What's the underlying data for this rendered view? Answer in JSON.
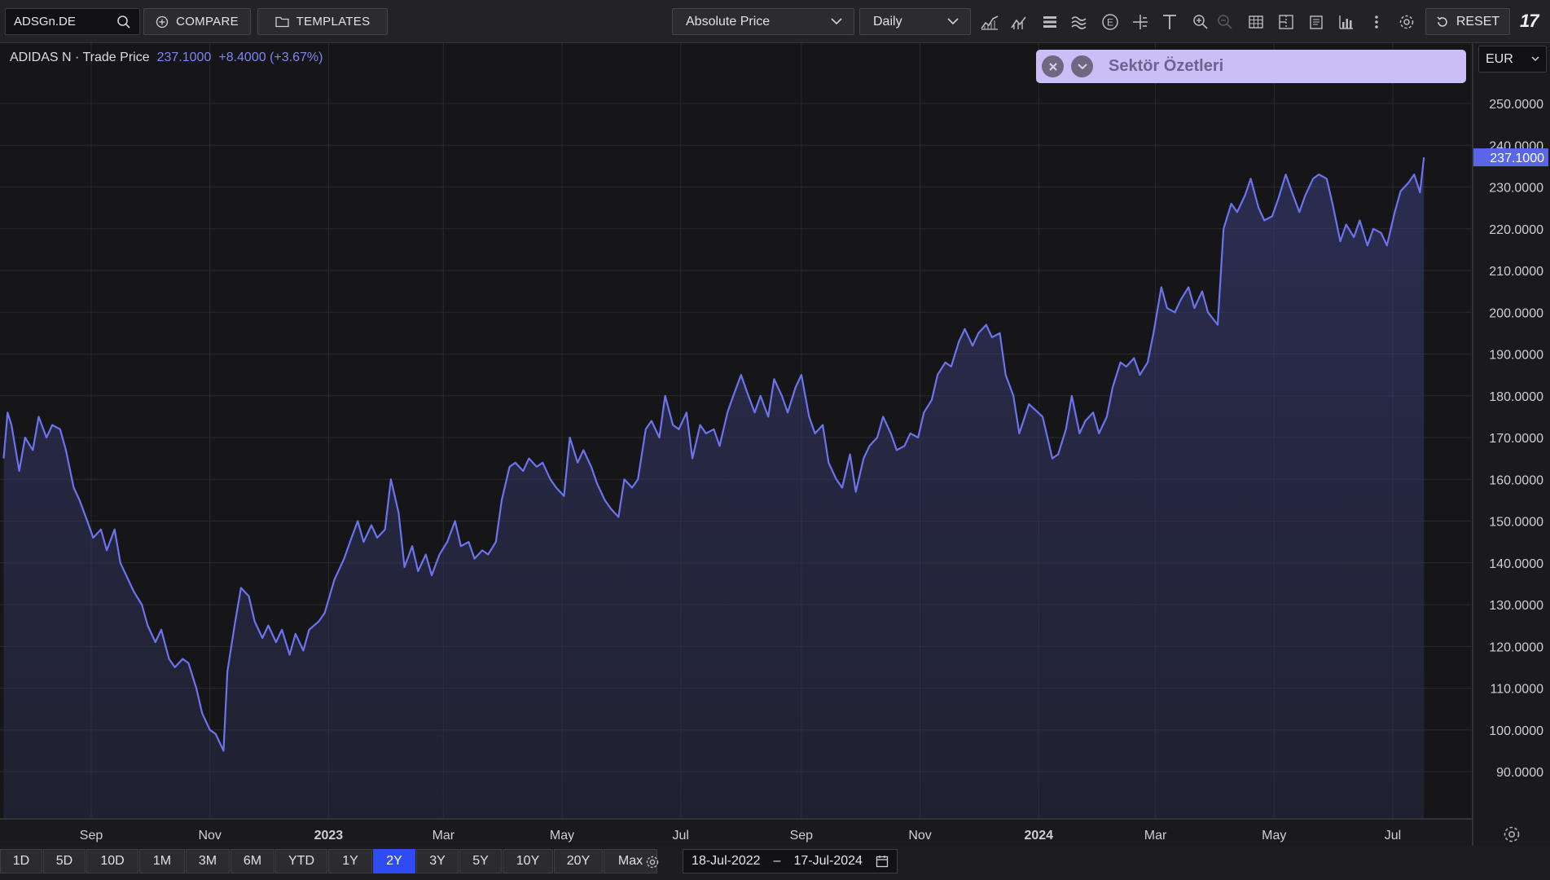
{
  "toolbar": {
    "symbol": "ADSGn.DE",
    "compare_label": "COMPARE",
    "templates_label": "TEMPLATES",
    "price_mode": "Absolute Price",
    "interval": "Daily",
    "reset_label": "RESET",
    "logo_text": "17"
  },
  "legend": {
    "name": "ADIDAS N · Trade Price",
    "last": "237.1000",
    "change": "+8.4000 (+3.67%)"
  },
  "panel": {
    "title": "Sektör Özetleri"
  },
  "currency": "EUR",
  "range_buttons": [
    "1D",
    "5D",
    "10D",
    "1M",
    "3M",
    "6M",
    "YTD",
    "1Y",
    "2Y",
    "3Y",
    "5Y",
    "10Y",
    "20Y",
    "Max"
  ],
  "active_range": "2Y",
  "date_range": {
    "start": "18-Jul-2022",
    "separator": "–",
    "end": "17-Jul-2024"
  },
  "colors": {
    "line": "#6b74ee",
    "active": "#2f4bf2",
    "panel": "#cbbdf5"
  },
  "chart_data": {
    "type": "area",
    "title": "ADIDAS N · Trade Price",
    "ylim": [
      80,
      260
    ],
    "y_ticks": [
      90,
      100,
      110,
      120,
      130,
      140,
      150,
      160,
      170,
      180,
      190,
      200,
      210,
      220,
      230,
      240,
      250
    ],
    "y_tick_labels": [
      "90.0000",
      "100.0000",
      "110.0000",
      "120.0000",
      "130.0000",
      "140.0000",
      "150.0000",
      "160.0000",
      "170.0000",
      "180.0000",
      "190.0000",
      "200.0000",
      "210.0000",
      "220.0000",
      "230.0000",
      "240.0000",
      "250.0000"
    ],
    "last_value_label": "237.1000",
    "xlim": [
      "2022-07-18",
      "2024-08-15"
    ],
    "x_ticks": [
      {
        "date": "2022-09-01",
        "label": "Sep",
        "bold": false
      },
      {
        "date": "2022-11-01",
        "label": "Nov",
        "bold": false
      },
      {
        "date": "2023-01-01",
        "label": "2023",
        "bold": true
      },
      {
        "date": "2023-03-01",
        "label": "Mar",
        "bold": false
      },
      {
        "date": "2023-05-01",
        "label": "May",
        "bold": false
      },
      {
        "date": "2023-07-01",
        "label": "Jul",
        "bold": false
      },
      {
        "date": "2023-09-01",
        "label": "Sep",
        "bold": false
      },
      {
        "date": "2023-11-01",
        "label": "Nov",
        "bold": false
      },
      {
        "date": "2024-01-01",
        "label": "2024",
        "bold": true
      },
      {
        "date": "2024-03-01",
        "label": "Mar",
        "bold": false
      },
      {
        "date": "2024-05-01",
        "label": "May",
        "bold": false
      },
      {
        "date": "2024-07-01",
        "label": "Jul",
        "bold": false
      }
    ],
    "series": [
      {
        "name": "ADIDAS N · Trade Price",
        "points": [
          [
            "2022-07-18",
            165
          ],
          [
            "2022-07-20",
            176
          ],
          [
            "2022-07-22",
            173
          ],
          [
            "2022-07-26",
            162
          ],
          [
            "2022-07-29",
            170
          ],
          [
            "2022-08-02",
            167
          ],
          [
            "2022-08-05",
            175
          ],
          [
            "2022-08-09",
            170
          ],
          [
            "2022-08-12",
            173
          ],
          [
            "2022-08-16",
            172
          ],
          [
            "2022-08-19",
            167
          ],
          [
            "2022-08-23",
            158
          ],
          [
            "2022-08-26",
            155
          ],
          [
            "2022-08-30",
            150
          ],
          [
            "2022-09-02",
            146
          ],
          [
            "2022-09-06",
            148
          ],
          [
            "2022-09-09",
            143
          ],
          [
            "2022-09-13",
            148
          ],
          [
            "2022-09-16",
            140
          ],
          [
            "2022-09-20",
            136
          ],
          [
            "2022-09-23",
            133
          ],
          [
            "2022-09-27",
            130
          ],
          [
            "2022-09-30",
            125
          ],
          [
            "2022-10-04",
            121
          ],
          [
            "2022-10-07",
            124
          ],
          [
            "2022-10-11",
            117
          ],
          [
            "2022-10-14",
            115
          ],
          [
            "2022-10-18",
            117
          ],
          [
            "2022-10-21",
            116
          ],
          [
            "2022-10-25",
            110
          ],
          [
            "2022-10-28",
            104
          ],
          [
            "2022-11-01",
            100
          ],
          [
            "2022-11-04",
            99
          ],
          [
            "2022-11-08",
            95
          ],
          [
            "2022-11-10",
            114
          ],
          [
            "2022-11-14",
            126
          ],
          [
            "2022-11-17",
            134
          ],
          [
            "2022-11-21",
            132
          ],
          [
            "2022-11-24",
            126
          ],
          [
            "2022-11-28",
            122
          ],
          [
            "2022-12-01",
            125
          ],
          [
            "2022-12-05",
            121
          ],
          [
            "2022-12-08",
            124
          ],
          [
            "2022-12-12",
            118
          ],
          [
            "2022-12-15",
            123
          ],
          [
            "2022-12-19",
            119
          ],
          [
            "2022-12-22",
            124
          ],
          [
            "2022-12-27",
            126
          ],
          [
            "2022-12-30",
            128
          ],
          [
            "2023-01-04",
            136
          ],
          [
            "2023-01-09",
            141
          ],
          [
            "2023-01-12",
            145
          ],
          [
            "2023-01-16",
            150
          ],
          [
            "2023-01-19",
            145
          ],
          [
            "2023-01-23",
            149
          ],
          [
            "2023-01-26",
            146
          ],
          [
            "2023-01-30",
            148
          ],
          [
            "2023-02-02",
            160
          ],
          [
            "2023-02-06",
            152
          ],
          [
            "2023-02-09",
            139
          ],
          [
            "2023-02-13",
            144
          ],
          [
            "2023-02-16",
            138
          ],
          [
            "2023-02-20",
            142
          ],
          [
            "2023-02-23",
            137
          ],
          [
            "2023-02-27",
            142
          ],
          [
            "2023-03-03",
            145
          ],
          [
            "2023-03-07",
            150
          ],
          [
            "2023-03-10",
            144
          ],
          [
            "2023-03-14",
            145
          ],
          [
            "2023-03-17",
            141
          ],
          [
            "2023-03-21",
            143
          ],
          [
            "2023-03-24",
            142
          ],
          [
            "2023-03-28",
            145
          ],
          [
            "2023-03-31",
            155
          ],
          [
            "2023-04-04",
            163
          ],
          [
            "2023-04-07",
            164
          ],
          [
            "2023-04-11",
            162
          ],
          [
            "2023-04-14",
            165
          ],
          [
            "2023-04-18",
            163
          ],
          [
            "2023-04-21",
            164
          ],
          [
            "2023-04-25",
            160
          ],
          [
            "2023-04-28",
            158
          ],
          [
            "2023-05-02",
            156
          ],
          [
            "2023-05-05",
            170
          ],
          [
            "2023-05-09",
            164
          ],
          [
            "2023-05-12",
            167
          ],
          [
            "2023-05-16",
            163
          ],
          [
            "2023-05-19",
            159
          ],
          [
            "2023-05-23",
            155
          ],
          [
            "2023-05-26",
            153
          ],
          [
            "2023-05-30",
            151
          ],
          [
            "2023-06-02",
            160
          ],
          [
            "2023-06-06",
            158
          ],
          [
            "2023-06-09",
            160
          ],
          [
            "2023-06-13",
            172
          ],
          [
            "2023-06-16",
            174
          ],
          [
            "2023-06-20",
            170
          ],
          [
            "2023-06-23",
            180
          ],
          [
            "2023-06-27",
            173
          ],
          [
            "2023-06-30",
            172
          ],
          [
            "2023-07-04",
            176
          ],
          [
            "2023-07-07",
            165
          ],
          [
            "2023-07-11",
            173
          ],
          [
            "2023-07-14",
            171
          ],
          [
            "2023-07-18",
            172
          ],
          [
            "2023-07-21",
            168
          ],
          [
            "2023-07-25",
            176
          ],
          [
            "2023-07-28",
            180
          ],
          [
            "2023-08-01",
            185
          ],
          [
            "2023-08-04",
            181
          ],
          [
            "2023-08-08",
            176
          ],
          [
            "2023-08-11",
            180
          ],
          [
            "2023-08-15",
            175
          ],
          [
            "2023-08-18",
            184
          ],
          [
            "2023-08-22",
            180
          ],
          [
            "2023-08-25",
            176
          ],
          [
            "2023-08-29",
            182
          ],
          [
            "2023-09-01",
            185
          ],
          [
            "2023-09-05",
            175
          ],
          [
            "2023-09-08",
            171
          ],
          [
            "2023-09-12",
            173
          ],
          [
            "2023-09-15",
            164
          ],
          [
            "2023-09-19",
            160
          ],
          [
            "2023-09-22",
            158
          ],
          [
            "2023-09-26",
            166
          ],
          [
            "2023-09-29",
            157
          ],
          [
            "2023-10-03",
            165
          ],
          [
            "2023-10-06",
            168
          ],
          [
            "2023-10-10",
            170
          ],
          [
            "2023-10-13",
            175
          ],
          [
            "2023-10-17",
            171
          ],
          [
            "2023-10-20",
            167
          ],
          [
            "2023-10-24",
            168
          ],
          [
            "2023-10-27",
            171
          ],
          [
            "2023-10-31",
            170
          ],
          [
            "2023-11-03",
            176
          ],
          [
            "2023-11-07",
            179
          ],
          [
            "2023-11-10",
            185
          ],
          [
            "2023-11-14",
            188
          ],
          [
            "2023-11-17",
            187
          ],
          [
            "2023-11-21",
            193
          ],
          [
            "2023-11-24",
            196
          ],
          [
            "2023-11-28",
            192
          ],
          [
            "2023-12-01",
            195
          ],
          [
            "2023-12-05",
            197
          ],
          [
            "2023-12-08",
            194
          ],
          [
            "2023-12-12",
            195
          ],
          [
            "2023-12-15",
            185
          ],
          [
            "2023-12-19",
            180
          ],
          [
            "2023-12-22",
            171
          ],
          [
            "2023-12-27",
            178
          ],
          [
            "2024-01-03",
            175
          ],
          [
            "2024-01-08",
            165
          ],
          [
            "2024-01-11",
            166
          ],
          [
            "2024-01-15",
            172
          ],
          [
            "2024-01-18",
            180
          ],
          [
            "2024-01-22",
            171
          ],
          [
            "2024-01-25",
            174
          ],
          [
            "2024-01-29",
            176
          ],
          [
            "2024-02-01",
            171
          ],
          [
            "2024-02-05",
            175
          ],
          [
            "2024-02-08",
            182
          ],
          [
            "2024-02-12",
            188
          ],
          [
            "2024-02-15",
            187
          ],
          [
            "2024-02-19",
            189
          ],
          [
            "2024-02-22",
            185
          ],
          [
            "2024-02-26",
            188
          ],
          [
            "2024-02-29",
            195
          ],
          [
            "2024-03-04",
            206
          ],
          [
            "2024-03-07",
            201
          ],
          [
            "2024-03-11",
            200
          ],
          [
            "2024-03-14",
            203
          ],
          [
            "2024-03-18",
            206
          ],
          [
            "2024-03-21",
            201
          ],
          [
            "2024-03-25",
            205
          ],
          [
            "2024-03-28",
            200
          ],
          [
            "2024-04-02",
            197
          ],
          [
            "2024-04-05",
            220
          ],
          [
            "2024-04-09",
            226
          ],
          [
            "2024-04-12",
            224
          ],
          [
            "2024-04-16",
            228
          ],
          [
            "2024-04-19",
            232
          ],
          [
            "2024-04-23",
            225
          ],
          [
            "2024-04-26",
            222
          ],
          [
            "2024-04-30",
            223
          ],
          [
            "2024-05-03",
            227
          ],
          [
            "2024-05-07",
            233
          ],
          [
            "2024-05-10",
            229
          ],
          [
            "2024-05-14",
            224
          ],
          [
            "2024-05-17",
            228
          ],
          [
            "2024-05-21",
            232
          ],
          [
            "2024-05-24",
            233
          ],
          [
            "2024-05-28",
            232
          ],
          [
            "2024-05-31",
            226
          ],
          [
            "2024-06-04",
            217
          ],
          [
            "2024-06-07",
            221
          ],
          [
            "2024-06-11",
            218
          ],
          [
            "2024-06-14",
            222
          ],
          [
            "2024-06-18",
            216
          ],
          [
            "2024-06-21",
            220
          ],
          [
            "2024-06-25",
            219
          ],
          [
            "2024-06-28",
            216
          ],
          [
            "2024-07-02",
            224
          ],
          [
            "2024-07-05",
            229
          ],
          [
            "2024-07-09",
            231
          ],
          [
            "2024-07-12",
            233
          ],
          [
            "2024-07-15",
            228.7
          ],
          [
            "2024-07-17",
            237.1
          ]
        ]
      }
    ]
  }
}
